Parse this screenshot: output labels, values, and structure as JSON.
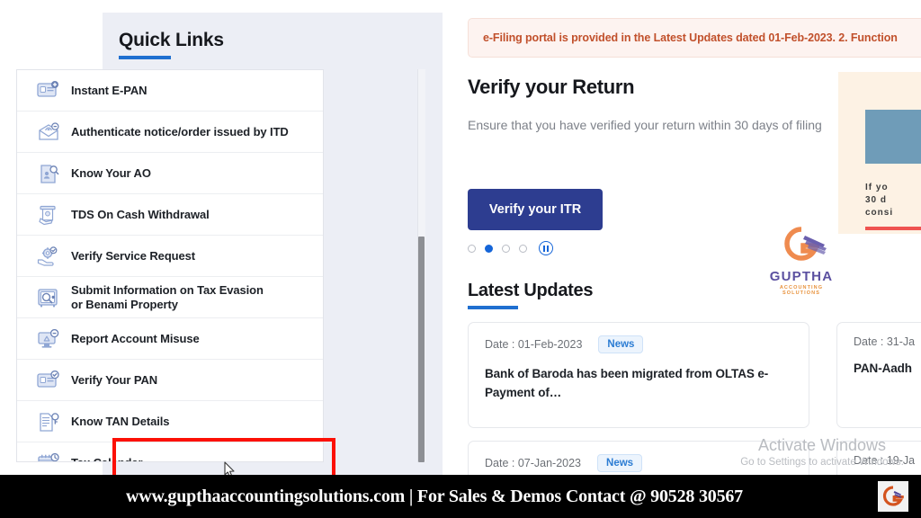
{
  "sidebar": {
    "title": "Quick Links",
    "items": [
      {
        "label": "Instant E-PAN",
        "icon": "id-card-plus-icon"
      },
      {
        "label": "Authenticate notice/order issued by ITD",
        "icon": "envelope-person-check-icon"
      },
      {
        "label": "Know Your AO",
        "icon": "document-person-search-icon"
      },
      {
        "label": "TDS On Cash Withdrawal",
        "icon": "atm-cash-icon"
      },
      {
        "label": "Verify Service Request",
        "icon": "hand-gear-check-icon"
      },
      {
        "label": "Submit Information on Tax Evasion or Benami Property",
        "icon": "safe-search-icon"
      },
      {
        "label": "Report Account Misuse",
        "icon": "monitor-alert-icon"
      },
      {
        "label": "Verify Your PAN",
        "icon": "id-card-check-icon"
      },
      {
        "label": "Know TAN Details",
        "icon": "document-key-icon"
      },
      {
        "label": "Tax Calendar",
        "icon": "calendar-clock-icon"
      }
    ],
    "highlighted_item": "Tax Calendar"
  },
  "alert": {
    "text": "e-Filing portal is provided in the Latest Updates dated 01-Feb-2023. 2. Function"
  },
  "hero": {
    "title": "Verify your Return",
    "subtitle": "Ensure that you have verified your return within 30 days of filing",
    "button_label": "Verify your ITR",
    "carousel": {
      "total_dots": 4,
      "active_index": 1,
      "pause_label": "pause-carousel"
    }
  },
  "promo": {
    "heading_lines": [
      "If yo",
      "30  d",
      "consi"
    ]
  },
  "brand": {
    "name": "GUPTHA",
    "tagline": "ACCOUNTING SOLUTIONS",
    "mark": "G",
    "name_color": "#5b50a0",
    "tagline_color": "#e8923c",
    "mark_color": "#ef8b4f"
  },
  "latest_updates": {
    "title": "Latest Updates",
    "cards": [
      {
        "date": "Date : 01-Feb-2023",
        "badge": "News",
        "body": "Bank of Baroda has been migrated from OLTAS e-Payment of…"
      },
      {
        "date": "Date : 31-Ja",
        "badge": "",
        "body": "PAN-Aadh"
      },
      {
        "date": "Date : 07-Jan-2023",
        "badge": "News",
        "body": ""
      },
      {
        "date": "Date : 19-Ja",
        "badge": "",
        "body": ""
      }
    ]
  },
  "windows_watermark": {
    "line1": "Activate Windows",
    "line2": "Go to Settings to activate Windows."
  },
  "bottom_banner": {
    "text": "www.gupthaaccountingsolutions.com | For Sales & Demos Contact @ 90528 30567"
  },
  "colors": {
    "accent_blue": "#1f6fd0",
    "button_navy": "#2d3d90",
    "alert_orange": "#c1502b",
    "highlight_red": "#fc1005"
  }
}
